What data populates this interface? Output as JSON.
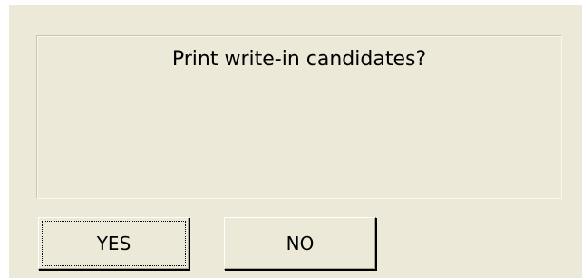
{
  "dialog": {
    "message": "Print write-in candidates?",
    "buttons": {
      "yes_label": "YES",
      "no_label": "NO"
    }
  },
  "colors": {
    "dialog_background": "#ece9d8",
    "text": "#000000"
  }
}
